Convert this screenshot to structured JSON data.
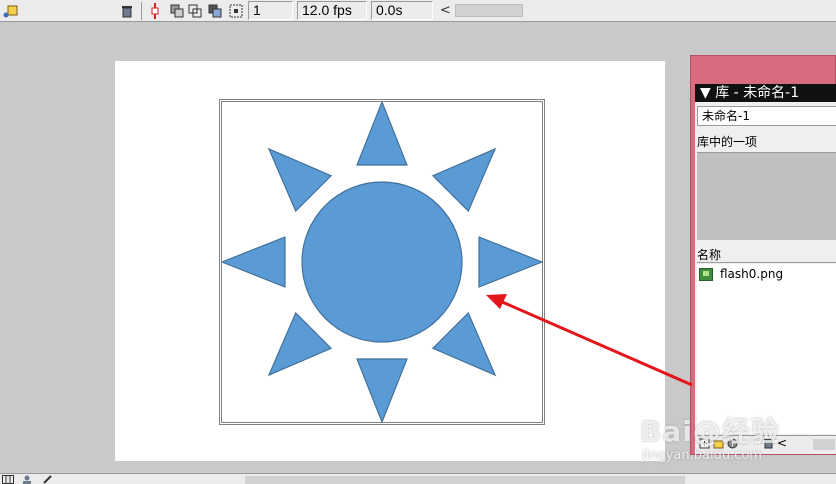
{
  "toolbar": {
    "frame": "1",
    "fps": "12.0 fps",
    "time": "0.0s",
    "scroll_left": "<",
    "icons": [
      "add-layer-icon",
      "trash-icon",
      "onion-skin-icon",
      "onion-outline-icon",
      "edit-multiple-frames-icon",
      "modify-markers-icon"
    ]
  },
  "library": {
    "title": "▼ 库 - 未命名-1",
    "document": "未命名-1",
    "item_count": "库中的一项",
    "column_name": "名称",
    "items": [
      {
        "name": "flash0.png",
        "icon": "bitmap-icon"
      }
    ],
    "footer_scroll_left": "<"
  },
  "watermark": {
    "main": "Bai@经验",
    "url": "jingyan.baidu.com"
  },
  "colors": {
    "sun_fill": "#5b9bd5",
    "sun_stroke": "#41719c",
    "arrow": "#e2161b",
    "panel_accent": "#d86b7e"
  }
}
